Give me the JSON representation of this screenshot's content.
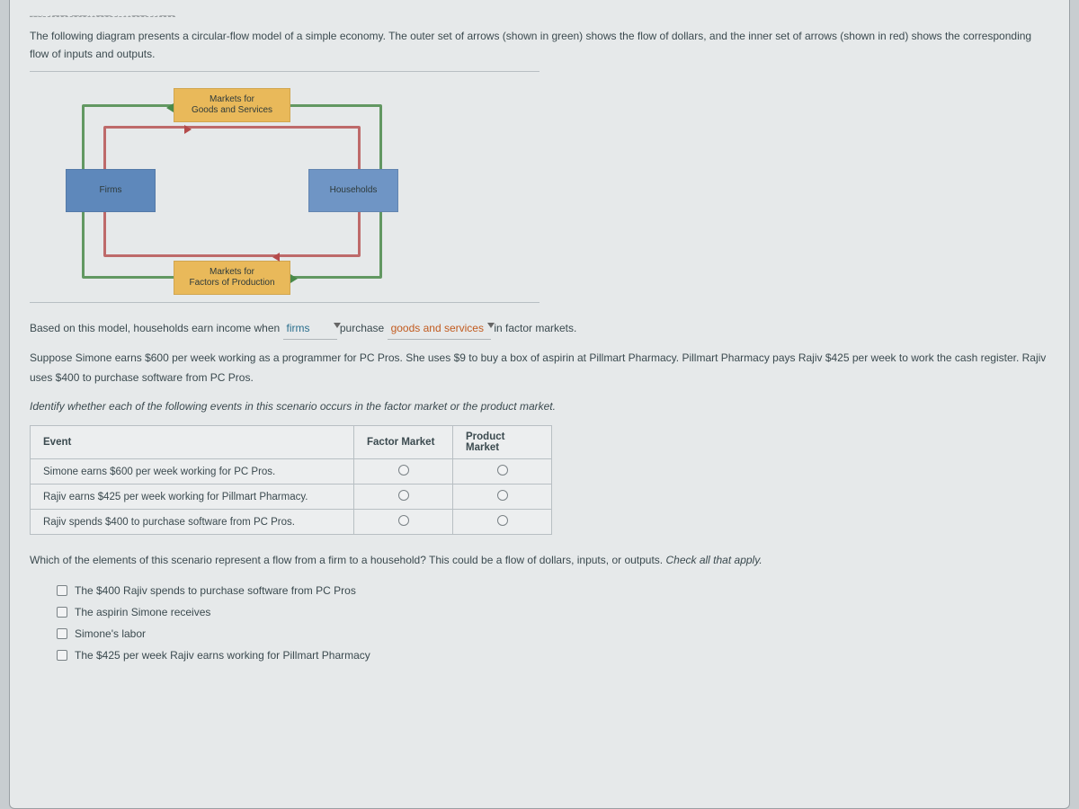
{
  "header_fragment": "—· ·── ──··── · ··── ··──",
  "intro_text": "The following diagram presents a circular-flow model of a simple economy. The outer set of arrows (shown in green) shows the flow of dollars, and the inner set of arrows (shown in red) shows the corresponding flow of inputs and outputs.",
  "diagram": {
    "firms": "Firms",
    "households": "Households",
    "goods_market": "Markets for\nGoods and Services",
    "factor_market": "Markets for\nFactors of Production"
  },
  "sentence": {
    "pre": "Based on this model, households earn income when ",
    "dd1": "firms",
    "mid": " purchase ",
    "dd2": "goods and services",
    "post": " in factor markets."
  },
  "scenario": "Suppose Simone earns $600 per week working as a programmer for PC Pros. She uses $9 to buy a box of aspirin at Pillmart Pharmacy. Pillmart Pharmacy pays Rajiv $425 per week to work the cash register. Rajiv uses $400 to purchase software from PC Pros.",
  "table_prompt": "Identify whether each of the following events in this scenario occurs in the factor market or the product market.",
  "table": {
    "h_event": "Event",
    "h_factor": "Factor Market",
    "h_product": "Product Market",
    "rows": [
      "Simone earns $600 per week working for PC Pros.",
      "Rajiv earns $425 per week working for Pillmart Pharmacy.",
      "Rajiv spends $400 to purchase software from PC Pros."
    ]
  },
  "final_q": {
    "text": "Which of the elements of this scenario represent a flow from a firm to a household? This could be a flow of dollars, inputs, or outputs. ",
    "italic": "Check all that apply."
  },
  "options": [
    "The $400 Rajiv spends to purchase software from PC Pros",
    "The aspirin Simone receives",
    "Simone's labor",
    "The $425 per week Rajiv earns working for Pillmart Pharmacy"
  ]
}
